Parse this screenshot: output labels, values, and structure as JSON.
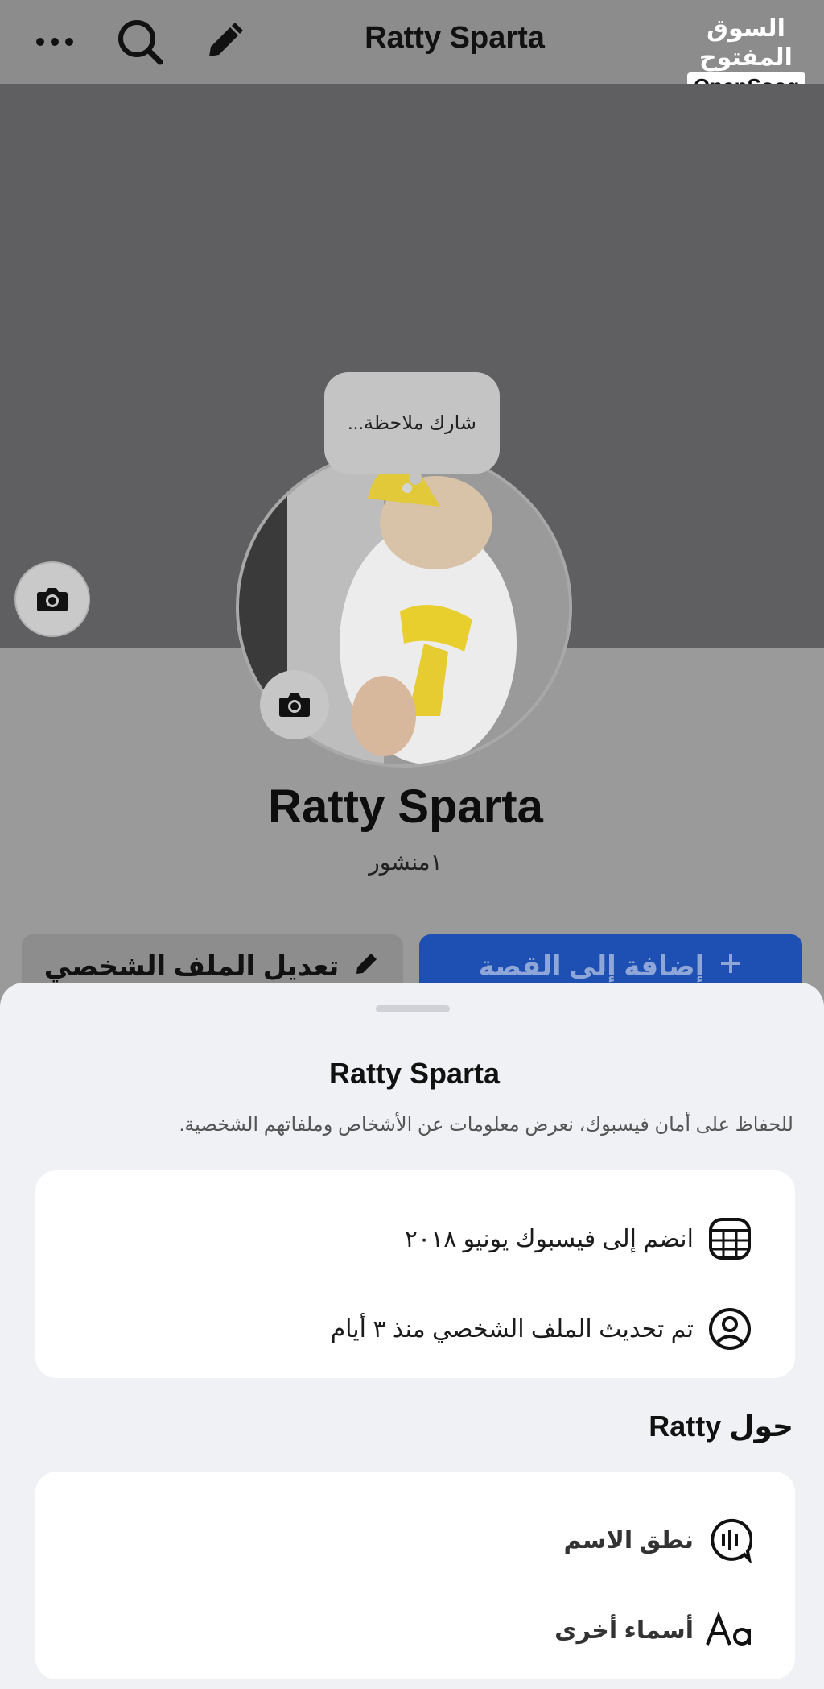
{
  "header": {
    "title": "Ratty Sparta",
    "logo_arabic": "السوق المفتوح",
    "logo_english": "OpenSooq"
  },
  "note": {
    "placeholder": "شارك ملاحظة..."
  },
  "profile": {
    "name": "Ratty Sparta",
    "posts": "١منشور"
  },
  "actions": {
    "add_story": "إضافة إلى القصة",
    "edit_profile": "تعديل الملف الشخصي"
  },
  "sheet": {
    "title": "Ratty Sparta",
    "subtitle": "للحفاظ على أمان فيسبوك، نعرض معلومات عن الأشخاص وملفاتهم الشخصية.",
    "info": [
      {
        "icon": "calendar-icon",
        "text": "انضم إلى فيسبوك يونيو ٢٠١٨"
      },
      {
        "icon": "profile-circle-icon",
        "text": "تم تحديث الملف الشخصي منذ ٣ أيام"
      }
    ],
    "about_heading": "حول Ratty",
    "about_items": [
      {
        "icon": "name-pronunciation-icon",
        "text": "نطق الاسم"
      },
      {
        "icon": "text-aa-icon",
        "text": "أسماء أخرى"
      }
    ]
  }
}
